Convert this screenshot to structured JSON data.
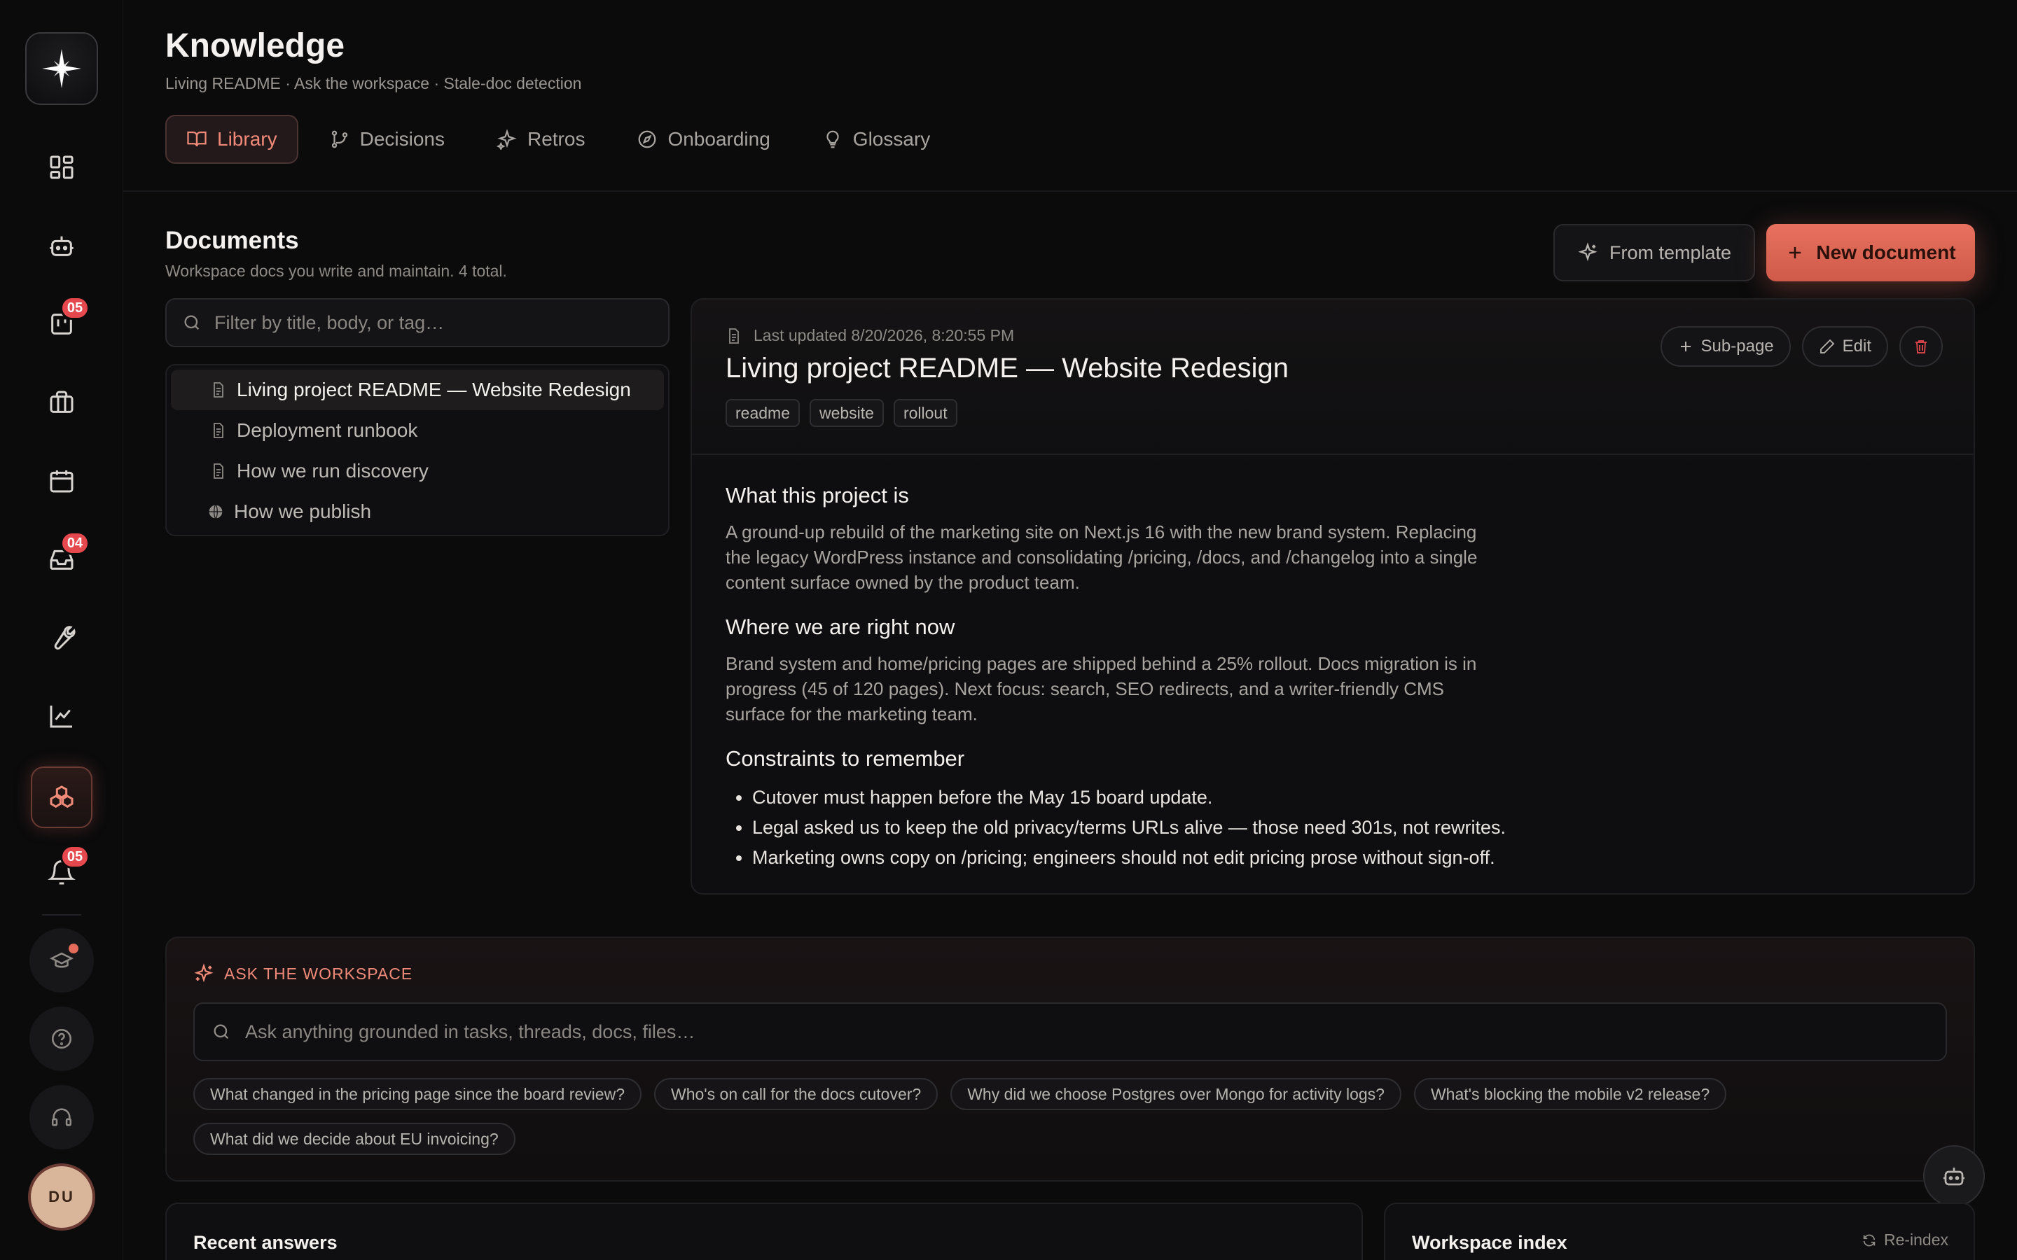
{
  "header": {
    "title": "Knowledge",
    "subtitle": "Living README · Ask the workspace · Stale-doc detection"
  },
  "tabs": [
    {
      "label": "Library",
      "icon": "book-open-icon",
      "active": true
    },
    {
      "label": "Decisions",
      "icon": "git-branch-icon",
      "active": false
    },
    {
      "label": "Retros",
      "icon": "sparkles-icon",
      "active": false
    },
    {
      "label": "Onboarding",
      "icon": "compass-icon",
      "active": false
    },
    {
      "label": "Glossary",
      "icon": "lightbulb-icon",
      "active": false
    }
  ],
  "sidebar": {
    "badges": {
      "projects": "05",
      "inbox": "04",
      "notifications": "05"
    },
    "avatar_initials": "DU"
  },
  "documents": {
    "title": "Documents",
    "subtitle": "Workspace docs you write and maintain. 4 total.",
    "from_template_label": "From template",
    "new_document_label": "New document",
    "filter_placeholder": "Filter by title, body, or tag…",
    "items": [
      {
        "title": "Living project README — Website Redesign",
        "icon": "file-icon",
        "active": true
      },
      {
        "title": "Deployment runbook",
        "icon": "file-icon",
        "active": false
      },
      {
        "title": "How we run discovery",
        "icon": "file-icon",
        "active": false
      },
      {
        "title": "How we publish",
        "icon": "globe-icon",
        "active": false
      }
    ]
  },
  "doc": {
    "last_updated": "Last updated 8/20/2026, 8:20:55 PM",
    "title": "Living project README — Website Redesign",
    "tags": [
      "readme",
      "website",
      "rollout"
    ],
    "actions": {
      "subpage": "Sub-page",
      "edit": "Edit"
    },
    "sections": {
      "s1_heading": "What this project is",
      "s1_body": "A ground-up rebuild of the marketing site on Next.js 16 with the new brand system. Replacing the legacy WordPress instance and consolidating /pricing, /docs, and /changelog into a single content surface owned by the product team.",
      "s2_heading": "Where we are right now",
      "s2_body": "Brand system and home/pricing pages are shipped behind a 25% rollout. Docs migration is in progress (45 of 120 pages). Next focus: search, SEO redirects, and a writer-friendly CMS surface for the marketing team.",
      "s3_heading": "Constraints to remember",
      "s3_items": [
        "Cutover must happen before the May 15 board update.",
        "Legal asked us to keep the old privacy/terms URLs alive — those need 301s, not rewrites.",
        "Marketing owns copy on /pricing; engineers should not edit pricing prose without sign-off."
      ]
    }
  },
  "ask": {
    "label": "ASK THE WORKSPACE",
    "placeholder": "Ask anything grounded in tasks, threads, docs, files…",
    "suggestions": [
      "What changed in the pricing page since the board review?",
      "Who's on call for the docs cutover?",
      "Why did we choose Postgres over Mongo for activity logs?",
      "What's blocking the mobile v2 release?",
      "What did we decide about EU invoicing?"
    ]
  },
  "recent_answers": {
    "title": "Recent answers"
  },
  "workspace_index": {
    "title": "Workspace index",
    "reindex_label": "Re-index"
  },
  "colors": {
    "accent": "#e8715f",
    "badge": "#e5484d",
    "background": "#0b0b0c"
  }
}
